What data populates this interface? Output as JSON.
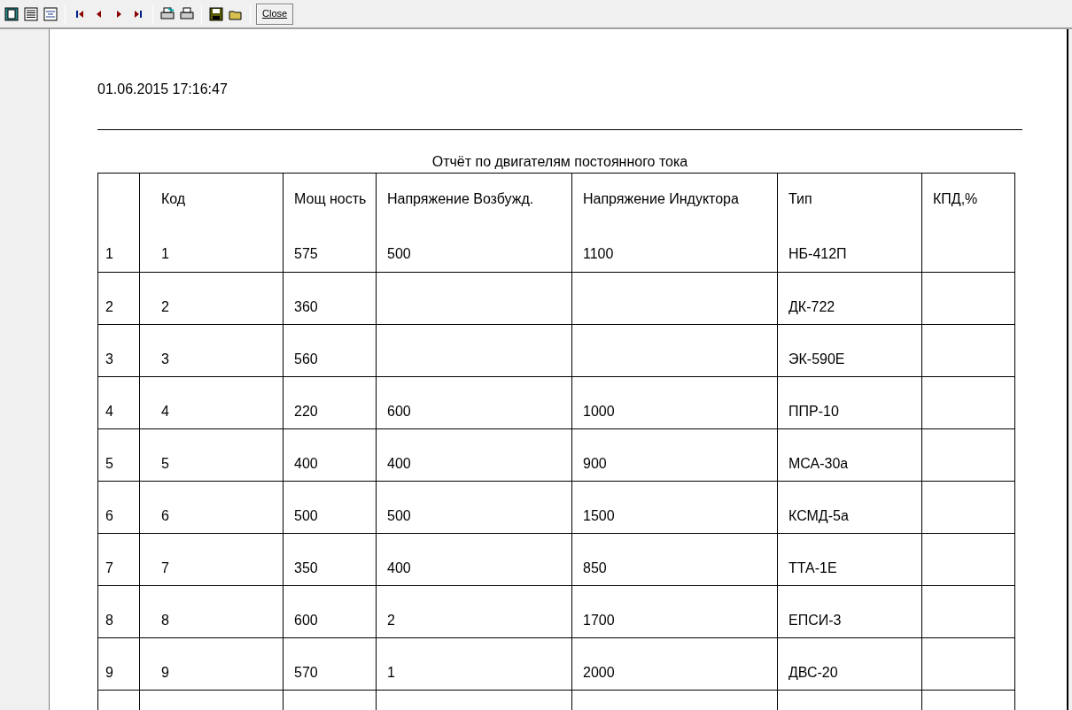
{
  "toolbar": {
    "close_label": "Close"
  },
  "report": {
    "timestamp": "01.06.2015 17:16:47",
    "title": "Отчёт по двигателям постоянного тока",
    "columns": [
      "",
      "Код",
      "Мощ ность",
      "Напряжение Возбужд.",
      "Напряжение Индуктора",
      "Тип",
      "КПД,%"
    ],
    "rows": [
      [
        "1",
        "1",
        "575",
        "500",
        "1100",
        "НБ-412П",
        ""
      ],
      [
        "2",
        "2",
        "360",
        "",
        "",
        "ДК-722",
        ""
      ],
      [
        "3",
        "3",
        "560",
        "",
        "",
        "ЭК-590Е",
        ""
      ],
      [
        "4",
        "4",
        "220",
        "600",
        "1000",
        "ППР-10",
        ""
      ],
      [
        "5",
        "5",
        "400",
        "400",
        "900",
        "МСА-30а",
        ""
      ],
      [
        "6",
        "6",
        "500",
        "500",
        "1500",
        "КСМД-5а",
        ""
      ],
      [
        "7",
        "7",
        "350",
        "400",
        "850",
        "ТТА-1Е",
        ""
      ],
      [
        "8",
        "8",
        "600",
        "2",
        "1700",
        "ЕПСИ-3",
        ""
      ],
      [
        "9",
        "9",
        "570",
        "1",
        "2000",
        "ДВС-20",
        ""
      ]
    ]
  }
}
